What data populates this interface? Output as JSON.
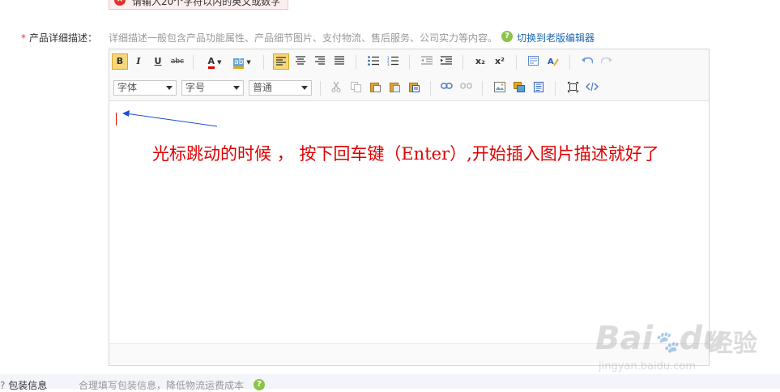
{
  "error_tip": {
    "icon": "close-circle-icon",
    "text": "请输入20个字符以内的英文或数字"
  },
  "description": {
    "required_mark": "*",
    "label": "产品详细描述：",
    "hint": "详细描述一般包含产品功能属性、产品细节图片、支付物流、售后服务、公司实力等内容。",
    "switch_icon": "question-icon",
    "switch_link": "切换到老版编辑器"
  },
  "toolbar": {
    "bold": "B",
    "italic": "I",
    "underline": "U",
    "strikethrough": "abc",
    "font_color": "A",
    "bg_color": "ab",
    "subscript": "x₂",
    "superscript": "x²",
    "font_family": "字体",
    "font_size": "字号",
    "paragraph": "普通"
  },
  "annotation": {
    "text": "光标跳动的时候 ， 按下回车键（Enter）,开始插入图片描述就好了"
  },
  "packaging": {
    "label": "包装信息",
    "hint": "合理填写包装信息，降低物流运费成本",
    "icon": "question-icon"
  },
  "watermark": {
    "brand": "Bai",
    "brand_suffix": "du",
    "cn": "经验",
    "url": "jingyan.baidu.com"
  },
  "colors": {
    "accent": "#1a66b3",
    "error": "#e0322a",
    "annotation": "#e00000",
    "arrow": "#1a4fd6",
    "help": "#8cc34b"
  }
}
